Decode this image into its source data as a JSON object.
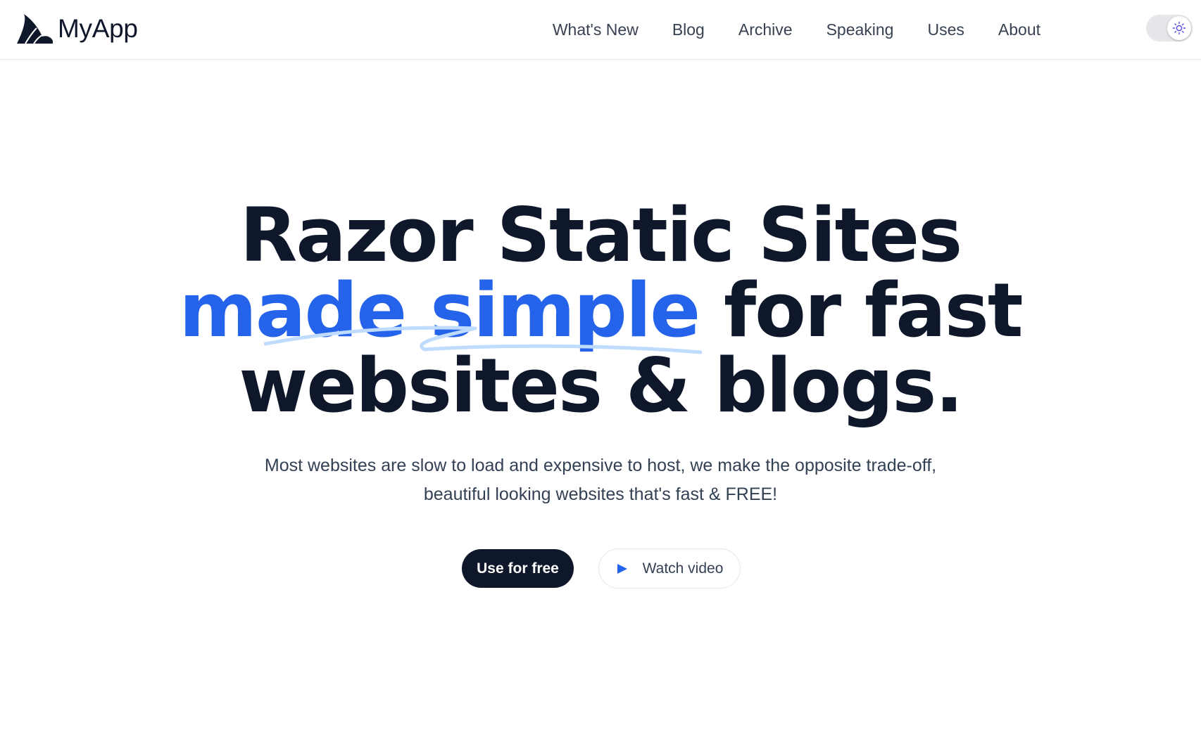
{
  "brand": {
    "name": "MyApp",
    "logo_icon": "shark-fin-icon"
  },
  "nav": {
    "items": [
      {
        "label": "What's New"
      },
      {
        "label": "Blog"
      },
      {
        "label": "Archive"
      },
      {
        "label": "Speaking"
      },
      {
        "label": "Uses"
      },
      {
        "label": "About"
      }
    ]
  },
  "theme_toggle": {
    "icon": "sun-icon",
    "state": "light"
  },
  "hero": {
    "headline_line1": "Razor Static Sites",
    "headline_highlight": "made simple",
    "headline_line2_rest": " for fast",
    "headline_line3": "websites & blogs.",
    "subtitle_line1": "Most websites are slow to load and expensive to host, we make the opposite trade-off,",
    "subtitle_line2": "beautiful looking websites that's fast & FREE!",
    "primary_cta": "Use for free",
    "secondary_cta": "Watch video",
    "secondary_cta_icon": "play-icon"
  },
  "colors": {
    "accent": "#2563eb",
    "text": "#0f172a",
    "scribble": "#bfdbfe",
    "primary_button": "#0f172a"
  }
}
